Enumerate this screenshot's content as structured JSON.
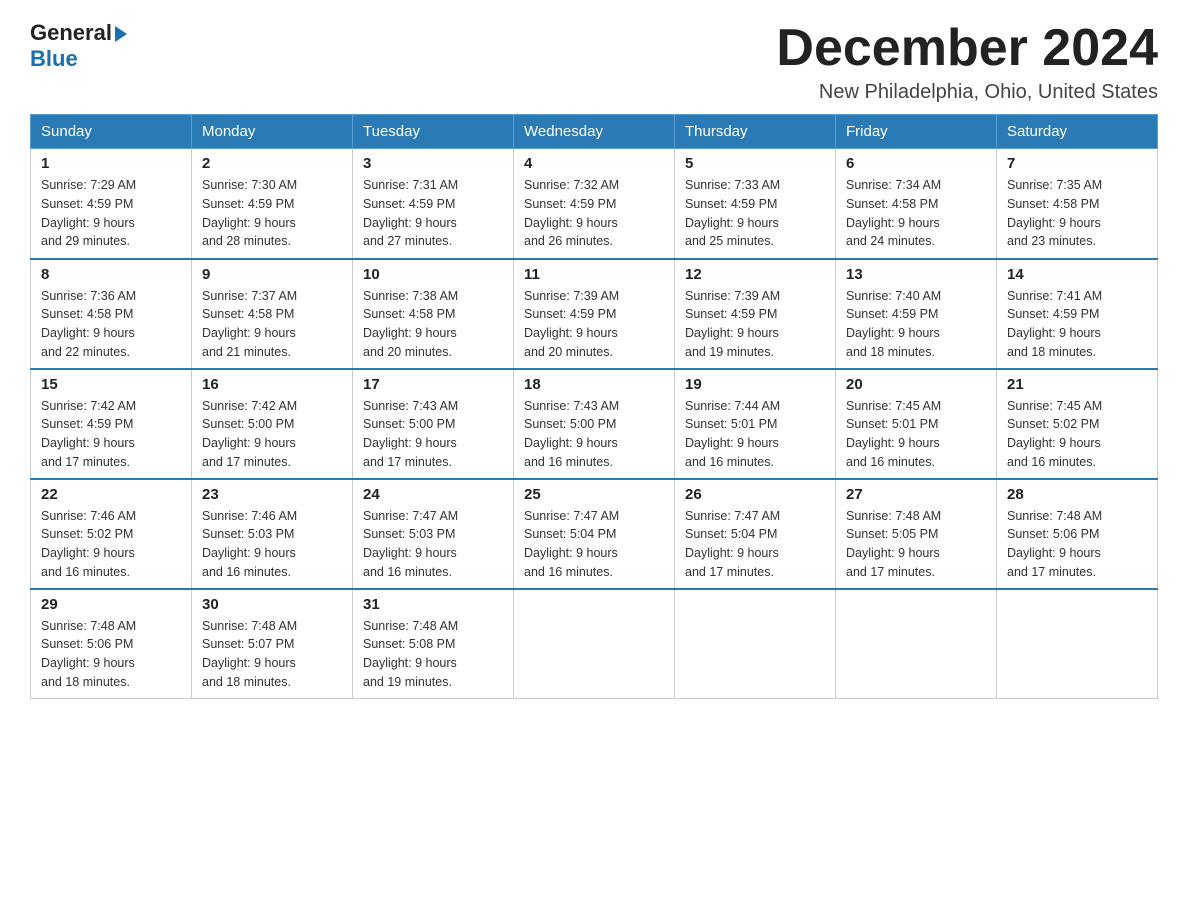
{
  "header": {
    "logo_general": "General",
    "logo_blue": "Blue",
    "month_title": "December 2024",
    "location": "New Philadelphia, Ohio, United States"
  },
  "days_of_week": [
    "Sunday",
    "Monday",
    "Tuesday",
    "Wednesday",
    "Thursday",
    "Friday",
    "Saturday"
  ],
  "weeks": [
    [
      {
        "day": "1",
        "sunrise": "7:29 AM",
        "sunset": "4:59 PM",
        "daylight": "9 hours and 29 minutes."
      },
      {
        "day": "2",
        "sunrise": "7:30 AM",
        "sunset": "4:59 PM",
        "daylight": "9 hours and 28 minutes."
      },
      {
        "day": "3",
        "sunrise": "7:31 AM",
        "sunset": "4:59 PM",
        "daylight": "9 hours and 27 minutes."
      },
      {
        "day": "4",
        "sunrise": "7:32 AM",
        "sunset": "4:59 PM",
        "daylight": "9 hours and 26 minutes."
      },
      {
        "day": "5",
        "sunrise": "7:33 AM",
        "sunset": "4:59 PM",
        "daylight": "9 hours and 25 minutes."
      },
      {
        "day": "6",
        "sunrise": "7:34 AM",
        "sunset": "4:58 PM",
        "daylight": "9 hours and 24 minutes."
      },
      {
        "day": "7",
        "sunrise": "7:35 AM",
        "sunset": "4:58 PM",
        "daylight": "9 hours and 23 minutes."
      }
    ],
    [
      {
        "day": "8",
        "sunrise": "7:36 AM",
        "sunset": "4:58 PM",
        "daylight": "9 hours and 22 minutes."
      },
      {
        "day": "9",
        "sunrise": "7:37 AM",
        "sunset": "4:58 PM",
        "daylight": "9 hours and 21 minutes."
      },
      {
        "day": "10",
        "sunrise": "7:38 AM",
        "sunset": "4:58 PM",
        "daylight": "9 hours and 20 minutes."
      },
      {
        "day": "11",
        "sunrise": "7:39 AM",
        "sunset": "4:59 PM",
        "daylight": "9 hours and 20 minutes."
      },
      {
        "day": "12",
        "sunrise": "7:39 AM",
        "sunset": "4:59 PM",
        "daylight": "9 hours and 19 minutes."
      },
      {
        "day": "13",
        "sunrise": "7:40 AM",
        "sunset": "4:59 PM",
        "daylight": "9 hours and 18 minutes."
      },
      {
        "day": "14",
        "sunrise": "7:41 AM",
        "sunset": "4:59 PM",
        "daylight": "9 hours and 18 minutes."
      }
    ],
    [
      {
        "day": "15",
        "sunrise": "7:42 AM",
        "sunset": "4:59 PM",
        "daylight": "9 hours and 17 minutes."
      },
      {
        "day": "16",
        "sunrise": "7:42 AM",
        "sunset": "5:00 PM",
        "daylight": "9 hours and 17 minutes."
      },
      {
        "day": "17",
        "sunrise": "7:43 AM",
        "sunset": "5:00 PM",
        "daylight": "9 hours and 17 minutes."
      },
      {
        "day": "18",
        "sunrise": "7:43 AM",
        "sunset": "5:00 PM",
        "daylight": "9 hours and 16 minutes."
      },
      {
        "day": "19",
        "sunrise": "7:44 AM",
        "sunset": "5:01 PM",
        "daylight": "9 hours and 16 minutes."
      },
      {
        "day": "20",
        "sunrise": "7:45 AM",
        "sunset": "5:01 PM",
        "daylight": "9 hours and 16 minutes."
      },
      {
        "day": "21",
        "sunrise": "7:45 AM",
        "sunset": "5:02 PM",
        "daylight": "9 hours and 16 minutes."
      }
    ],
    [
      {
        "day": "22",
        "sunrise": "7:46 AM",
        "sunset": "5:02 PM",
        "daylight": "9 hours and 16 minutes."
      },
      {
        "day": "23",
        "sunrise": "7:46 AM",
        "sunset": "5:03 PM",
        "daylight": "9 hours and 16 minutes."
      },
      {
        "day": "24",
        "sunrise": "7:47 AM",
        "sunset": "5:03 PM",
        "daylight": "9 hours and 16 minutes."
      },
      {
        "day": "25",
        "sunrise": "7:47 AM",
        "sunset": "5:04 PM",
        "daylight": "9 hours and 16 minutes."
      },
      {
        "day": "26",
        "sunrise": "7:47 AM",
        "sunset": "5:04 PM",
        "daylight": "9 hours and 17 minutes."
      },
      {
        "day": "27",
        "sunrise": "7:48 AM",
        "sunset": "5:05 PM",
        "daylight": "9 hours and 17 minutes."
      },
      {
        "day": "28",
        "sunrise": "7:48 AM",
        "sunset": "5:06 PM",
        "daylight": "9 hours and 17 minutes."
      }
    ],
    [
      {
        "day": "29",
        "sunrise": "7:48 AM",
        "sunset": "5:06 PM",
        "daylight": "9 hours and 18 minutes."
      },
      {
        "day": "30",
        "sunrise": "7:48 AM",
        "sunset": "5:07 PM",
        "daylight": "9 hours and 18 minutes."
      },
      {
        "day": "31",
        "sunrise": "7:48 AM",
        "sunset": "5:08 PM",
        "daylight": "9 hours and 19 minutes."
      },
      null,
      null,
      null,
      null
    ]
  ],
  "labels": {
    "sunrise": "Sunrise:",
    "sunset": "Sunset:",
    "daylight": "Daylight:"
  }
}
